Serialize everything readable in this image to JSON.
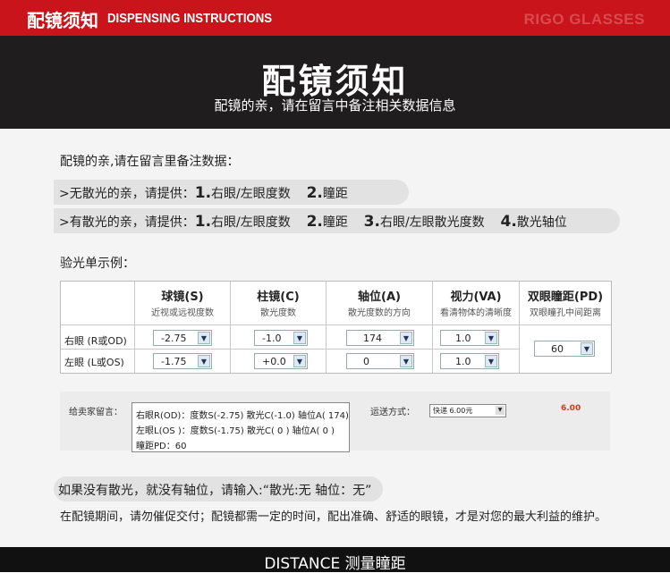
{
  "header": {
    "title_cn": "配镜须知",
    "title_en": "DISPENSING INSTRUCTIONS",
    "brand": "RIGO GLASSES"
  },
  "hero": {
    "title": "配镜须知",
    "subtitle": "配镜的亲，请在留言中备注相关数据信息"
  },
  "intro": "配镜的亲,请在留言里备注数据：",
  "no_astig": {
    "prefix": ">无散光的亲，请提供：",
    "n1": "1.",
    "item1": "右眼/左眼度数",
    "n2": "2.",
    "item2": "瞳距"
  },
  "with_astig": {
    "prefix": ">有散光的亲，请提供：",
    "n1": "1.",
    "item1": "右眼/左眼度数",
    "n2": "2.",
    "item2": "瞳距",
    "n3": "3.",
    "item3": "右眼/左眼散光度数",
    "n4": "4.",
    "item4": "散光轴位"
  },
  "example_label": "验光单示例：",
  "rx_table": {
    "columns": [
      {
        "title": "球镜(S)",
        "desc": "近视或远视度数"
      },
      {
        "title": "柱镜(C)",
        "desc": "散光度数"
      },
      {
        "title": "轴位(A)",
        "desc": "散光度数的方向"
      },
      {
        "title": "视力(VA)",
        "desc": "看清物体的清晰度"
      },
      {
        "title": "双眼瞳距(PD)",
        "desc": "双眼瞳孔中间距离"
      }
    ],
    "right_eye": {
      "label": "右眼 (R或OD)",
      "sph": "-2.75",
      "cyl": "-1.0",
      "axis": "174",
      "va": "1.0"
    },
    "left_eye": {
      "label": "左眼 (L或OS)",
      "sph": "-1.75",
      "cyl": "+0.0",
      "axis": "0",
      "va": "1.0"
    },
    "pd": "60"
  },
  "message": {
    "label": "给卖家留言：",
    "line1": "右眼R(OD)：度数S(-2.75)  散光C(-1.0)  轴位A( 174)",
    "line2": "左眼L(OS )：度数S(-1.75)  散光C( 0 )      轴位A( 0 )",
    "line3": "瞳距PD：60",
    "shipping_label": "运送方式：",
    "shipping_value": "快递 6.00元",
    "fee": "6.00"
  },
  "note": "如果没有散光，就没有轴位，请输入:“散光:无   轴位：无”",
  "reminder": "在配镜期间，请勿催促交付；配镜都需一定的时间，配出准确、舒适的眼镜，才是对您的最大利益的维护。",
  "footer": "DISTANCE 测量瞳距",
  "colors": {
    "brand_red": "#c8141a",
    "dark_band": "#1f1d1d",
    "panel_bg": "#f4f4f4",
    "fee_orange": "#d83a1a"
  }
}
